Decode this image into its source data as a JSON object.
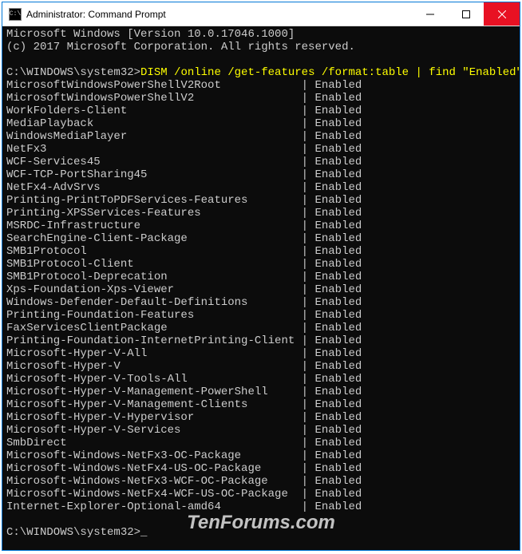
{
  "titlebar": {
    "title": "Administrator: Command Prompt"
  },
  "terminal": {
    "header_line1": "Microsoft Windows [Version 10.0.17046.1000]",
    "header_line2": "(c) 2017 Microsoft Corporation. All rights reserved.",
    "prompt1_path": "C:\\WINDOWS\\system32>",
    "command": "DISM /online /get-features /format:table | find \"Enabled\"",
    "prompt2_path": "C:\\WINDOWS\\system32>",
    "features": [
      {
        "name": "MicrosoftWindowsPowerShellV2Root",
        "status": "Enabled"
      },
      {
        "name": "MicrosoftWindowsPowerShellV2",
        "status": "Enabled"
      },
      {
        "name": "WorkFolders-Client",
        "status": "Enabled"
      },
      {
        "name": "MediaPlayback",
        "status": "Enabled"
      },
      {
        "name": "WindowsMediaPlayer",
        "status": "Enabled"
      },
      {
        "name": "NetFx3",
        "status": "Enabled"
      },
      {
        "name": "WCF-Services45",
        "status": "Enabled"
      },
      {
        "name": "WCF-TCP-PortSharing45",
        "status": "Enabled"
      },
      {
        "name": "NetFx4-AdvSrvs",
        "status": "Enabled"
      },
      {
        "name": "Printing-PrintToPDFServices-Features",
        "status": "Enabled"
      },
      {
        "name": "Printing-XPSServices-Features",
        "status": "Enabled"
      },
      {
        "name": "MSRDC-Infrastructure",
        "status": "Enabled"
      },
      {
        "name": "SearchEngine-Client-Package",
        "status": "Enabled"
      },
      {
        "name": "SMB1Protocol",
        "status": "Enabled"
      },
      {
        "name": "SMB1Protocol-Client",
        "status": "Enabled"
      },
      {
        "name": "SMB1Protocol-Deprecation",
        "status": "Enabled"
      },
      {
        "name": "Xps-Foundation-Xps-Viewer",
        "status": "Enabled"
      },
      {
        "name": "Windows-Defender-Default-Definitions",
        "status": "Enabled"
      },
      {
        "name": "Printing-Foundation-Features",
        "status": "Enabled"
      },
      {
        "name": "FaxServicesClientPackage",
        "status": "Enabled"
      },
      {
        "name": "Printing-Foundation-InternetPrinting-Client",
        "status": "Enabled"
      },
      {
        "name": "Microsoft-Hyper-V-All",
        "status": "Enabled"
      },
      {
        "name": "Microsoft-Hyper-V",
        "status": "Enabled"
      },
      {
        "name": "Microsoft-Hyper-V-Tools-All",
        "status": "Enabled"
      },
      {
        "name": "Microsoft-Hyper-V-Management-PowerShell",
        "status": "Enabled"
      },
      {
        "name": "Microsoft-Hyper-V-Management-Clients",
        "status": "Enabled"
      },
      {
        "name": "Microsoft-Hyper-V-Hypervisor",
        "status": "Enabled"
      },
      {
        "name": "Microsoft-Hyper-V-Services",
        "status": "Enabled"
      },
      {
        "name": "SmbDirect",
        "status": "Enabled"
      },
      {
        "name": "Microsoft-Windows-NetFx3-OC-Package",
        "status": "Enabled"
      },
      {
        "name": "Microsoft-Windows-NetFx4-US-OC-Package",
        "status": "Enabled"
      },
      {
        "name": "Microsoft-Windows-NetFx3-WCF-OC-Package",
        "status": "Enabled"
      },
      {
        "name": "Microsoft-Windows-NetFx4-WCF-US-OC-Package",
        "status": "Enabled"
      },
      {
        "name": "Internet-Explorer-Optional-amd64",
        "status": "Enabled"
      }
    ]
  },
  "watermark": "TenForums.com",
  "layout": {
    "name_col_width": 44
  }
}
